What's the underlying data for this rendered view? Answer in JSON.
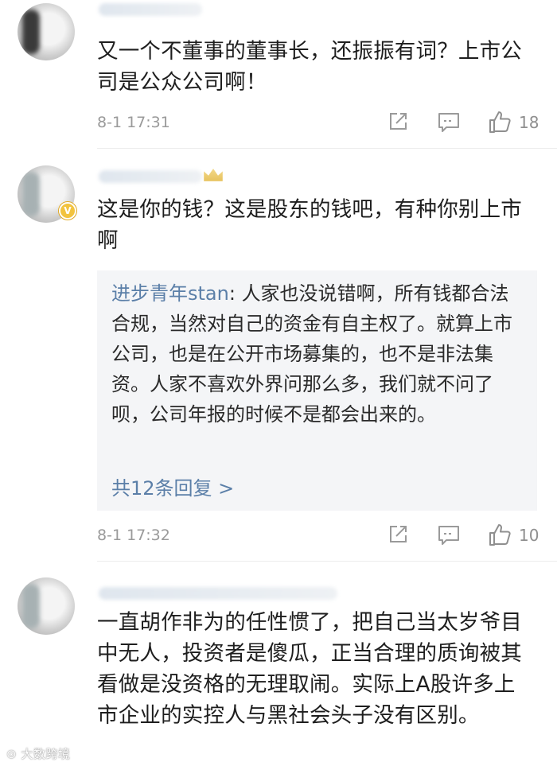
{
  "comments": [
    {
      "text": "又一个不董事的董事长，还振振有词？上市公司是公众公司啊！",
      "time": "8-1 17:31",
      "likes": "18"
    },
    {
      "text": "这是你的钱？这是股东的钱吧，有种你别上市啊",
      "time": "8-1 17:32",
      "likes": "10",
      "reply": {
        "author": "进步青年stan",
        "separator": ": ",
        "text": "人家也没说错啊，所有钱都合法合规，当然对自己的资金有自主权了。就算上市公司，也是在公开市场募集的，也不是非法集资。人家不喜欢外界问那么多，我们就不问了呗，公司年报的时候不是都会出来的。",
        "more": "共12条回复 >"
      }
    },
    {
      "text": "一直胡作非为的任性惯了，把自己当太岁爷目中无人，投资者是傻瓜，正当合理的质询被其看做是没资格的无理取闹。实际上A股许多上市企业的实控人与黑社会头子没有区别。"
    }
  ],
  "icons": {
    "share": "share-icon",
    "comment": "comment-icon",
    "like": "thumbs-up-icon",
    "verified": "verified-badge-icon"
  },
  "colors": {
    "link": "#5b7fa8",
    "meta": "#9a9a9a",
    "reply_bg": "#f4f5f7",
    "badge": "#f2c33f"
  }
}
